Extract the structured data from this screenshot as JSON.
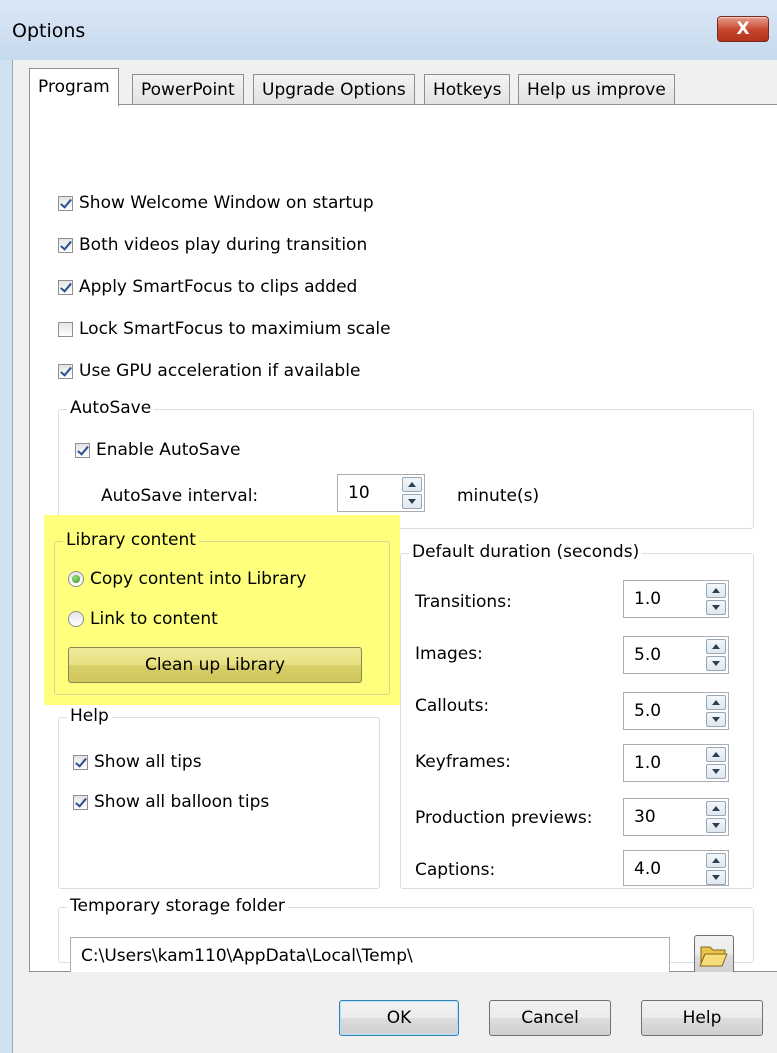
{
  "window": {
    "title": "Options",
    "close_label": "X"
  },
  "tabs": [
    {
      "label": "Program",
      "active": true
    },
    {
      "label": "PowerPoint"
    },
    {
      "label": "Upgrade Options"
    },
    {
      "label": "Hotkeys"
    },
    {
      "label": "Help us improve"
    }
  ],
  "program": {
    "checkboxes": [
      {
        "label": "Show Welcome Window on startup",
        "checked": true
      },
      {
        "label": "Both videos play during transition",
        "checked": true
      },
      {
        "label": "Apply SmartFocus to clips added",
        "checked": true
      },
      {
        "label": "Lock SmartFocus to maximium scale",
        "checked": false
      },
      {
        "label": "Use GPU acceleration if available",
        "checked": true
      }
    ],
    "autosave": {
      "legend": "AutoSave",
      "enable_label": "Enable AutoSave",
      "interval_label": "AutoSave interval:",
      "interval_value": "10",
      "unit": "minute(s)"
    },
    "library": {
      "legend": "Library content",
      "option_copy": "Copy content into Library",
      "option_link": "Link to content",
      "selected": "copy",
      "cleanup_label": "Clean up Library",
      "highlight_color": "#fdff7d"
    },
    "help": {
      "legend": "Help",
      "show_tips": "Show all tips",
      "show_balloon": "Show all balloon tips"
    },
    "durations": {
      "legend": "Default duration (seconds)",
      "items": [
        {
          "label": "Transitions:",
          "value": "1.0"
        },
        {
          "label": "Images:",
          "value": "5.0"
        },
        {
          "label": "Callouts:",
          "value": "5.0"
        },
        {
          "label": "Keyframes:",
          "value": "1.0"
        },
        {
          "label": "Production previews:",
          "value": "30"
        },
        {
          "label": "Captions:",
          "value": "4.0"
        }
      ]
    },
    "temp": {
      "legend": "Temporary storage folder",
      "path": "C:\\Users\\kam110\\AppData\\Local\\Temp\\",
      "browse_icon": "folder-open-icon"
    }
  },
  "buttons": {
    "ok": "OK",
    "cancel": "Cancel",
    "help": "Help"
  }
}
